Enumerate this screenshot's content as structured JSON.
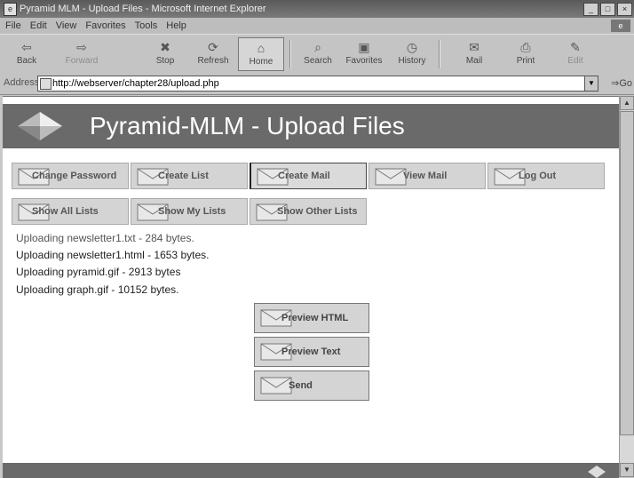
{
  "window": {
    "title": "Pyramid MLM - Upload Files - Microsoft Internet Explorer"
  },
  "menu": [
    "File",
    "Edit",
    "View",
    "Favorites",
    "Tools",
    "Help"
  ],
  "toolbar": {
    "back": "Back",
    "forward": "Forward",
    "stop": "Stop",
    "refresh": "Refresh",
    "home": "Home",
    "search": "Search",
    "favorites": "Favorites",
    "history": "History",
    "mail": "Mail",
    "print": "Print",
    "edit": "Edit"
  },
  "address": {
    "label": "Address",
    "url": "http://webserver/chapter28/upload.php",
    "go": "Go"
  },
  "page": {
    "title": "Pyramid-MLM - Upload Files",
    "nav_row1": [
      "Change Password",
      "Create List",
      "Create Mail",
      "View Mail",
      "Log Out"
    ],
    "nav_row2": [
      "Show All Lists",
      "Show My Lists",
      "Show Other Lists"
    ],
    "upload_lines": [
      "Uploading newsletter1.txt - 284 bytes.",
      "Uploading newsletter1.html - 1653 bytes.",
      "Uploading pyramid.gif - 2913 bytes",
      "Uploading graph.gif - 10152 bytes."
    ],
    "actions": [
      "Preview HTML",
      "Preview Text",
      "Send"
    ]
  }
}
